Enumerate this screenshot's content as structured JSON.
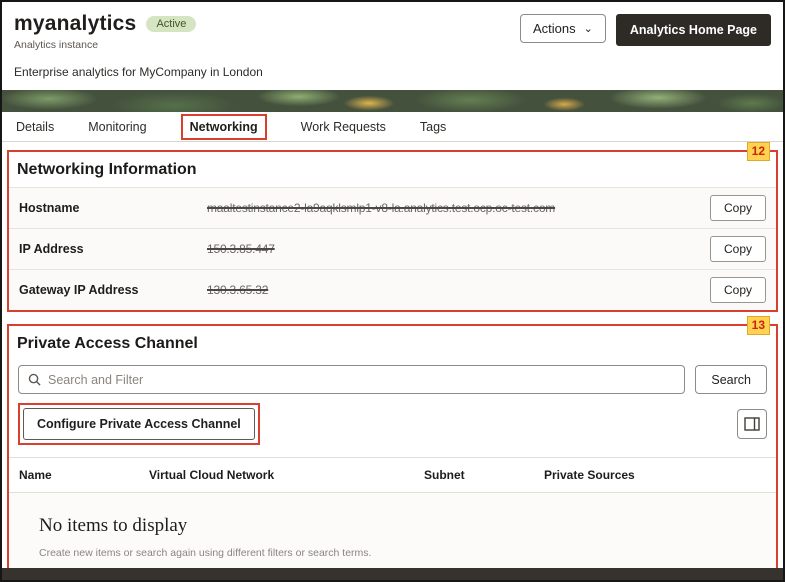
{
  "header": {
    "title": "myanalytics",
    "status_badge": "Active",
    "subtitle": "Analytics instance",
    "description": "Enterprise analytics for MyCompany in London",
    "actions_button": "Actions",
    "home_button": "Analytics Home Page"
  },
  "tabs": [
    {
      "label": "Details"
    },
    {
      "label": "Monitoring"
    },
    {
      "label": "Networking"
    },
    {
      "label": "Work Requests"
    },
    {
      "label": "Tags"
    }
  ],
  "annotations": {
    "networking_callout": "12",
    "private_access_callout": "13"
  },
  "networking": {
    "title": "Networking Information",
    "rows": [
      {
        "label": "Hostname",
        "value": "maaltestinstance2-la9aqklsmlp1-v8-la.analytics.test.ocp.oc-test.com",
        "button": "Copy"
      },
      {
        "label": "IP Address",
        "value": "150.3.85.447",
        "button": "Copy"
      },
      {
        "label": "Gateway IP Address",
        "value": "130.3.65.32",
        "button": "Copy"
      }
    ]
  },
  "private_access": {
    "title": "Private Access Channel",
    "search": {
      "placeholder": "Search and Filter",
      "button": "Search"
    },
    "configure_button": "Configure Private Access Channel",
    "table_headers": {
      "name": "Name",
      "vcn": "Virtual Cloud Network",
      "subnet": "Subnet",
      "sources": "Private Sources"
    },
    "empty_title": "No items to display",
    "empty_subtitle": "Create new items or search again using different filters or search terms."
  },
  "colors": {
    "annotation_red": "#d7402e",
    "callout_yellow": "#ffd34f",
    "badge_green": "#d5e5c2",
    "dark_button": "#2e2a25",
    "banner_green": "#44513d"
  }
}
